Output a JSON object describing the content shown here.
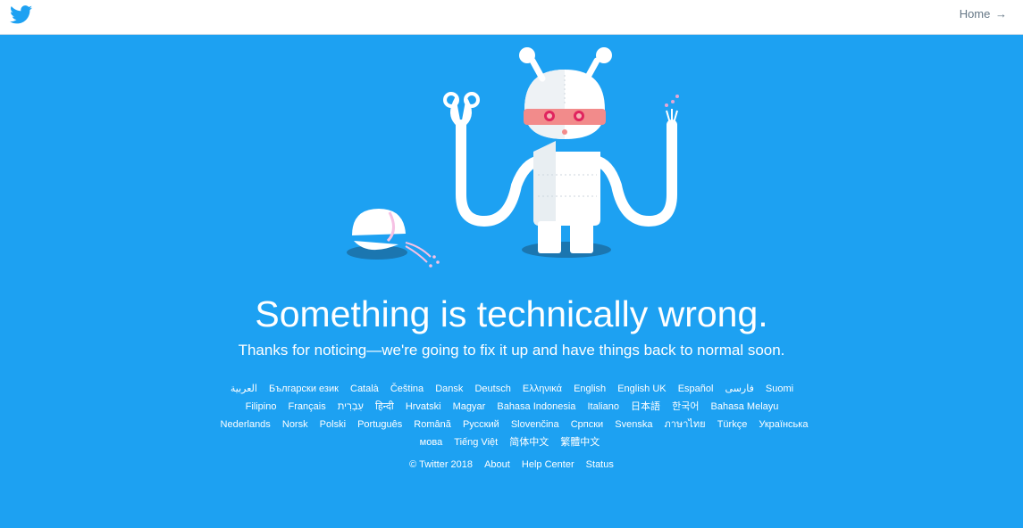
{
  "topbar": {
    "logo_icon": "twitter-bird-icon",
    "home_label": "Home",
    "home_arrow": "→"
  },
  "illustration": {
    "icon": "broken-robot-illustration"
  },
  "message": {
    "title": "Something is technically wrong.",
    "subtitle": "Thanks for noticing—we're going to fix it up and have things back to normal soon."
  },
  "languages": [
    "العربية",
    "Български език",
    "Català",
    "Čeština",
    "Dansk",
    "Deutsch",
    "Ελληνικά",
    "English",
    "English UK",
    "Español",
    "فارسی",
    "Suomi",
    "Filipino",
    "Français",
    "עִבְרִית",
    "हिन्दी",
    "Hrvatski",
    "Magyar",
    "Bahasa Indonesia",
    "Italiano",
    "日本語",
    "한국어",
    "Bahasa Melayu",
    "Nederlands",
    "Norsk",
    "Polski",
    "Português",
    "Română",
    "Русский",
    "Slovenčina",
    "Српски",
    "Svenska",
    "ภาษาไทย",
    "Türkçe",
    "Українська мова",
    "Tiếng Việt",
    "简体中文",
    "繁體中文"
  ],
  "footer": {
    "copyright": "© Twitter 2018",
    "about": "About",
    "help_center": "Help Center",
    "status": "Status"
  },
  "colors": {
    "background": "#1da1f2",
    "topbar": "#ffffff",
    "brand": "#1da1f2"
  }
}
